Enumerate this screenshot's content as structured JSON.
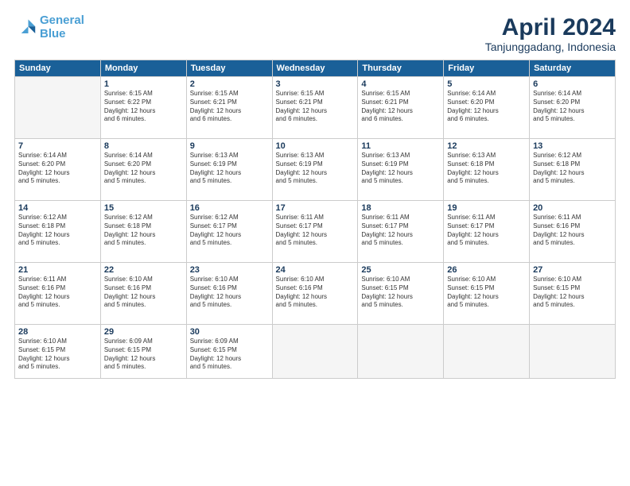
{
  "logo": {
    "line1": "General",
    "line2": "Blue"
  },
  "title": "April 2024",
  "location": "Tanjunggadang, Indonesia",
  "days_of_week": [
    "Sunday",
    "Monday",
    "Tuesday",
    "Wednesday",
    "Thursday",
    "Friday",
    "Saturday"
  ],
  "weeks": [
    [
      {
        "day": "",
        "info": ""
      },
      {
        "day": "1",
        "info": "Sunrise: 6:15 AM\nSunset: 6:22 PM\nDaylight: 12 hours\nand 6 minutes."
      },
      {
        "day": "2",
        "info": "Sunrise: 6:15 AM\nSunset: 6:21 PM\nDaylight: 12 hours\nand 6 minutes."
      },
      {
        "day": "3",
        "info": "Sunrise: 6:15 AM\nSunset: 6:21 PM\nDaylight: 12 hours\nand 6 minutes."
      },
      {
        "day": "4",
        "info": "Sunrise: 6:15 AM\nSunset: 6:21 PM\nDaylight: 12 hours\nand 6 minutes."
      },
      {
        "day": "5",
        "info": "Sunrise: 6:14 AM\nSunset: 6:20 PM\nDaylight: 12 hours\nand 6 minutes."
      },
      {
        "day": "6",
        "info": "Sunrise: 6:14 AM\nSunset: 6:20 PM\nDaylight: 12 hours\nand 5 minutes."
      }
    ],
    [
      {
        "day": "7",
        "info": "Sunrise: 6:14 AM\nSunset: 6:20 PM\nDaylight: 12 hours\nand 5 minutes."
      },
      {
        "day": "8",
        "info": "Sunrise: 6:14 AM\nSunset: 6:20 PM\nDaylight: 12 hours\nand 5 minutes."
      },
      {
        "day": "9",
        "info": "Sunrise: 6:13 AM\nSunset: 6:19 PM\nDaylight: 12 hours\nand 5 minutes."
      },
      {
        "day": "10",
        "info": "Sunrise: 6:13 AM\nSunset: 6:19 PM\nDaylight: 12 hours\nand 5 minutes."
      },
      {
        "day": "11",
        "info": "Sunrise: 6:13 AM\nSunset: 6:19 PM\nDaylight: 12 hours\nand 5 minutes."
      },
      {
        "day": "12",
        "info": "Sunrise: 6:13 AM\nSunset: 6:18 PM\nDaylight: 12 hours\nand 5 minutes."
      },
      {
        "day": "13",
        "info": "Sunrise: 6:12 AM\nSunset: 6:18 PM\nDaylight: 12 hours\nand 5 minutes."
      }
    ],
    [
      {
        "day": "14",
        "info": "Sunrise: 6:12 AM\nSunset: 6:18 PM\nDaylight: 12 hours\nand 5 minutes."
      },
      {
        "day": "15",
        "info": "Sunrise: 6:12 AM\nSunset: 6:18 PM\nDaylight: 12 hours\nand 5 minutes."
      },
      {
        "day": "16",
        "info": "Sunrise: 6:12 AM\nSunset: 6:17 PM\nDaylight: 12 hours\nand 5 minutes."
      },
      {
        "day": "17",
        "info": "Sunrise: 6:11 AM\nSunset: 6:17 PM\nDaylight: 12 hours\nand 5 minutes."
      },
      {
        "day": "18",
        "info": "Sunrise: 6:11 AM\nSunset: 6:17 PM\nDaylight: 12 hours\nand 5 minutes."
      },
      {
        "day": "19",
        "info": "Sunrise: 6:11 AM\nSunset: 6:17 PM\nDaylight: 12 hours\nand 5 minutes."
      },
      {
        "day": "20",
        "info": "Sunrise: 6:11 AM\nSunset: 6:16 PM\nDaylight: 12 hours\nand 5 minutes."
      }
    ],
    [
      {
        "day": "21",
        "info": "Sunrise: 6:11 AM\nSunset: 6:16 PM\nDaylight: 12 hours\nand 5 minutes."
      },
      {
        "day": "22",
        "info": "Sunrise: 6:10 AM\nSunset: 6:16 PM\nDaylight: 12 hours\nand 5 minutes."
      },
      {
        "day": "23",
        "info": "Sunrise: 6:10 AM\nSunset: 6:16 PM\nDaylight: 12 hours\nand 5 minutes."
      },
      {
        "day": "24",
        "info": "Sunrise: 6:10 AM\nSunset: 6:16 PM\nDaylight: 12 hours\nand 5 minutes."
      },
      {
        "day": "25",
        "info": "Sunrise: 6:10 AM\nSunset: 6:15 PM\nDaylight: 12 hours\nand 5 minutes."
      },
      {
        "day": "26",
        "info": "Sunrise: 6:10 AM\nSunset: 6:15 PM\nDaylight: 12 hours\nand 5 minutes."
      },
      {
        "day": "27",
        "info": "Sunrise: 6:10 AM\nSunset: 6:15 PM\nDaylight: 12 hours\nand 5 minutes."
      }
    ],
    [
      {
        "day": "28",
        "info": "Sunrise: 6:10 AM\nSunset: 6:15 PM\nDaylight: 12 hours\nand 5 minutes."
      },
      {
        "day": "29",
        "info": "Sunrise: 6:09 AM\nSunset: 6:15 PM\nDaylight: 12 hours\nand 5 minutes."
      },
      {
        "day": "30",
        "info": "Sunrise: 6:09 AM\nSunset: 6:15 PM\nDaylight: 12 hours\nand 5 minutes."
      },
      {
        "day": "",
        "info": ""
      },
      {
        "day": "",
        "info": ""
      },
      {
        "day": "",
        "info": ""
      },
      {
        "day": "",
        "info": ""
      }
    ]
  ]
}
